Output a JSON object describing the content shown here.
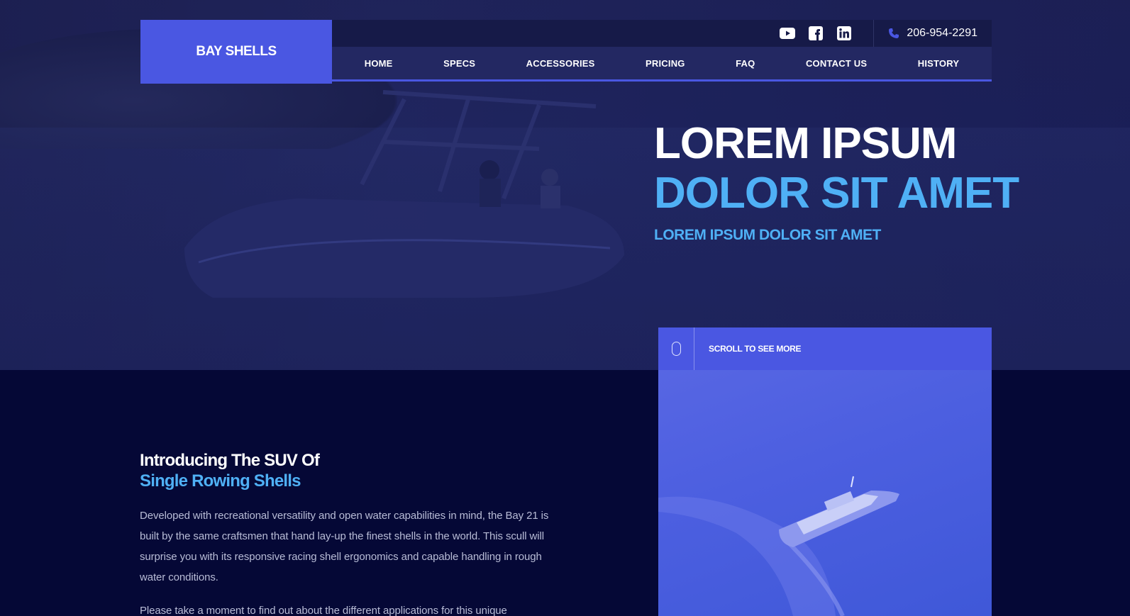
{
  "brand": {
    "name": "BAY SHELLS"
  },
  "topbar": {
    "social": [
      "youtube-icon",
      "facebook-icon",
      "linkedin-icon"
    ],
    "phone": "206-954-2291"
  },
  "nav": {
    "items": [
      "HOME",
      "SPECS",
      "ACCESSORIES",
      "PRICING",
      "FAQ",
      "CONTACT US",
      "HISTORY"
    ]
  },
  "hero": {
    "line1": "LOREM IPSUM",
    "line2": "DOLOR SIT AMET",
    "subtitle": "LOREM IPSUM DOLOR SIT AMET"
  },
  "scroll": {
    "label": "SCROLL TO SEE MORE"
  },
  "intro": {
    "heading_line1": "Introducing The SUV Of",
    "heading_line2": "Single Rowing Shells",
    "paragraph1": "Developed with recreational versatility and open water capabilities in mind, the Bay 21 is built by the same craftsmen that hand lay-up the finest shells in the world. This scull will surprise you with its responsive racing shell ergonomics and capable handling in rough water conditions.",
    "paragraph2": "Please take a moment to find out about the different applications for this unique"
  },
  "colors": {
    "accent": "#4a57e2",
    "highlight": "#4fb0f5",
    "background": "#050836"
  }
}
